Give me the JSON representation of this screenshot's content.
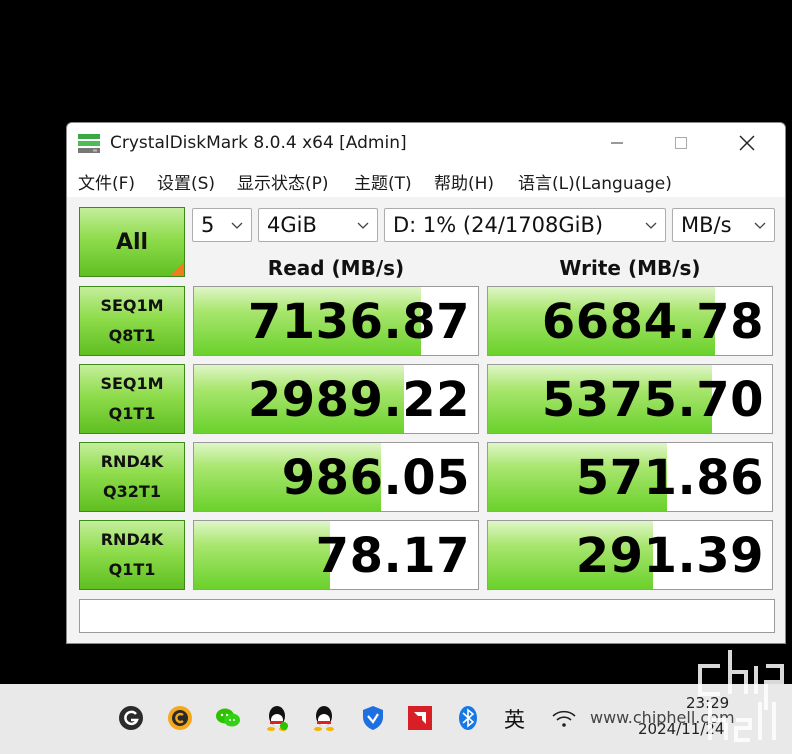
{
  "window": {
    "title": "CrystalDiskMark 8.0.4 x64 [Admin]",
    "app_icon": "disk-icon",
    "controls": [
      "minimize-icon",
      "maximize-icon",
      "close-icon"
    ]
  },
  "menu": [
    "文件(F)",
    "设置(S)",
    "显示状态(P)",
    "主题(T)",
    "帮助(H)",
    "语言(L)(Language)"
  ],
  "controls": {
    "all_label": "All",
    "count": "5",
    "size": "4GiB",
    "drive": "D: 1% (24/1708GiB)",
    "unit": "MB/s"
  },
  "headers": {
    "read": "Read (MB/s)",
    "write": "Write (MB/s)"
  },
  "results": [
    {
      "line1": "SEQ1M",
      "line2": "Q8T1",
      "read": "7136.87",
      "write": "6684.78",
      "read_fill": 0.8,
      "write_fill": 0.8
    },
    {
      "line1": "SEQ1M",
      "line2": "Q1T1",
      "read": "2989.22",
      "write": "5375.70",
      "read_fill": 0.74,
      "write_fill": 0.79
    },
    {
      "line1": "RND4K",
      "line2": "Q32T1",
      "read": "986.05",
      "write": "571.86",
      "read_fill": 0.66,
      "write_fill": 0.63
    },
    {
      "line1": "RND4K",
      "line2": "Q1T1",
      "read": "78.17",
      "write": "291.39",
      "read_fill": 0.48,
      "write_fill": 0.58
    }
  ],
  "status_text": "",
  "taskbar": {
    "icons": [
      "g-app-icon",
      "cloud-music-icon",
      "wechat-icon",
      "qq-icon",
      "qq-2-icon",
      "shield-icon",
      "amd-icon",
      "bluetooth-icon"
    ],
    "ime": "英",
    "time": "23:29",
    "date": "2024/11/24",
    "watermark_url": "www.chiphell.com",
    "colors": {
      "green": "#6ad12b",
      "accent_orange": "#f07c1c"
    }
  }
}
